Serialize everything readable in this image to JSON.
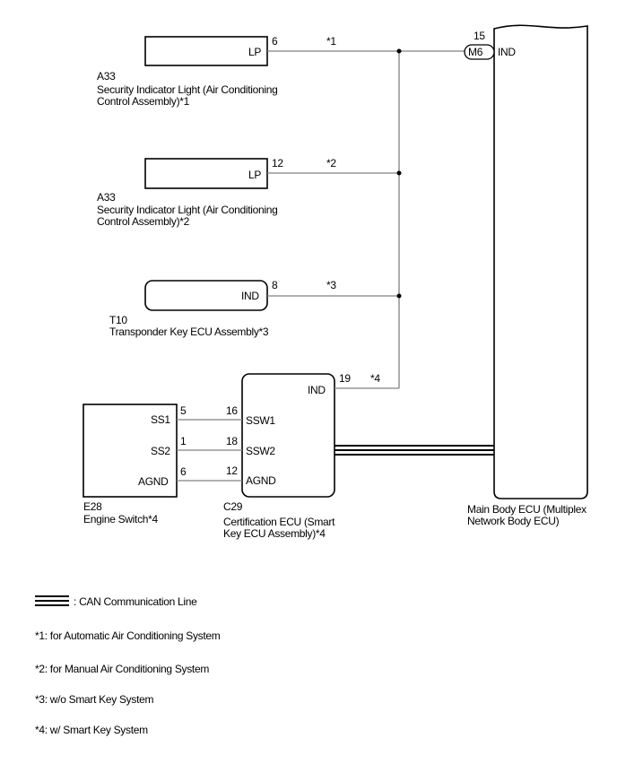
{
  "diagram": {
    "components": {
      "a33_auto": {
        "code": "A33",
        "name_line1": "Security Indicator Light (Air Conditioning",
        "name_line2": "Control Assembly)*1",
        "terminal": "LP",
        "pin": "6",
        "wire_note": "*1"
      },
      "a33_manual": {
        "code": "A33",
        "name_line1": "Security Indicator Light (Air Conditioning",
        "name_line2": "Control Assembly)*2",
        "terminal": "LP",
        "pin": "12",
        "wire_note": "*2"
      },
      "t10": {
        "code": "T10",
        "name_line1": "Transponder Key ECU Assembly*3",
        "terminal": "IND",
        "pin": "8",
        "wire_note": "*3"
      },
      "e28": {
        "code": "E28",
        "name_line1": "Engine Switch*4",
        "terminals": [
          {
            "label": "SS1",
            "pin": "5"
          },
          {
            "label": "SS2",
            "pin": "1"
          },
          {
            "label": "AGND",
            "pin": "6"
          }
        ]
      },
      "c29": {
        "code": "C29",
        "name_line1": "Certification ECU (Smart",
        "name_line2": "Key ECU Assembly)*4",
        "ind_terminal": "IND",
        "ind_pin": "19",
        "ind_wire_note": "*4",
        "terminals": [
          {
            "label": "SSW1",
            "pin": "16"
          },
          {
            "label": "SSW2",
            "pin": "18"
          },
          {
            "label": "AGND",
            "pin": "12"
          }
        ]
      },
      "main_body_ecu": {
        "name_line1": "Main Body ECU (Multiplex",
        "name_line2": "Network Body ECU)",
        "terminal": "IND",
        "pin": "15",
        "connector": "M6"
      }
    },
    "legend": {
      "can_line": ": CAN Communication Line",
      "notes": [
        "*1: for Automatic Air Conditioning System",
        "*2: for Manual Air Conditioning System",
        "*3: w/o Smart Key System",
        "*4: w/ Smart Key System"
      ]
    }
  }
}
